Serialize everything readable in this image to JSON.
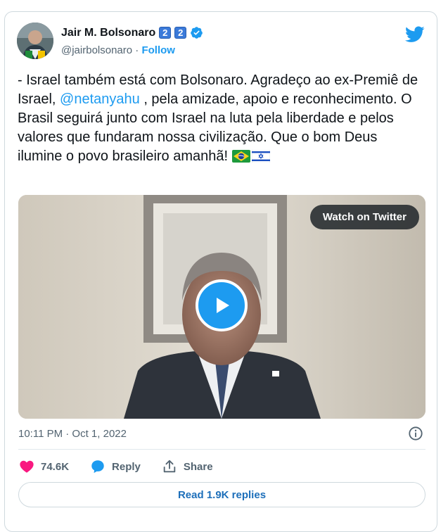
{
  "author": {
    "name": "Jair M. Bolsonaro",
    "badge_digits": [
      "2",
      "2"
    ],
    "handle": "@jairbolsonaro",
    "separator": "·",
    "follow_label": "Follow"
  },
  "tweet": {
    "text_before_mention": "- Israel também está com Bolsonaro. Agradeço ao ex-Premiê de Israel, ",
    "mention": "@netanyahu",
    "text_after_mention": " , pela amizade, apoio e reconhecimento. O Brasil seguirá junto com Israel na luta pela liberdade e pelos valores que fundaram nossa civilização. Que o bom Deus ilumine o povo brasileiro amanhã!",
    "flags": [
      "brazil-flag",
      "israel-flag"
    ]
  },
  "media": {
    "watch_label": "Watch on Twitter"
  },
  "timestamp": "10:11 PM · Oct 1, 2022",
  "actions": {
    "likes": "74.6K",
    "reply_label": "Reply",
    "share_label": "Share"
  },
  "read_replies_label": "Read 1.9K replies",
  "colors": {
    "accent": "#1d9bf0",
    "like": "#f91880",
    "text": "#0f1419",
    "muted": "#536471"
  }
}
